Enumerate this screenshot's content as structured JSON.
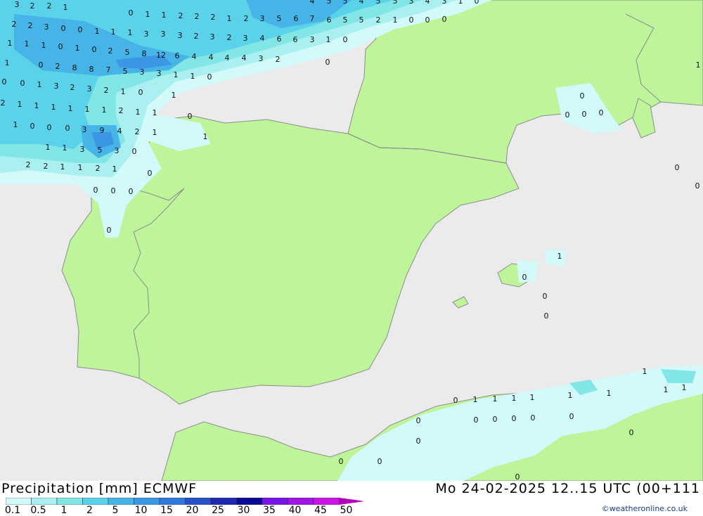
{
  "header": {
    "product": "Precipitation [mm]",
    "model": "ECMWF",
    "valid_time": "Mo 24-02-2025 12..15 UTC (00+111"
  },
  "legend": {
    "levels": [
      "0.1",
      "0.5",
      "1",
      "2",
      "5",
      "10",
      "15",
      "20",
      "25",
      "30",
      "35",
      "40",
      "45",
      "50"
    ],
    "colors": [
      "#d2fafa",
      "#aaf0f0",
      "#82e6e6",
      "#5ad2ea",
      "#46b4e6",
      "#3c96e6",
      "#3278dc",
      "#2850c8",
      "#1e28b4",
      "#0a0a96",
      "#7814e6",
      "#a014e6",
      "#c814e6",
      "#e614e6",
      "#f014c8",
      "#b400b4"
    ]
  },
  "credit": "©weatheronline.co.uk",
  "colors": {
    "sea": "#ebebeb",
    "land": "#bff59a",
    "border": "#8c8c8c"
  },
  "map_values": [
    {
      "t": "3"
    },
    {
      "t": "2"
    },
    {
      "t": "2"
    },
    {
      "t": "1"
    },
    {
      "t": "0"
    },
    {
      "t": "1"
    },
    {
      "t": "1"
    },
    {
      "t": "2"
    },
    {
      "t": "2"
    },
    {
      "t": "2"
    },
    {
      "t": "1"
    },
    {
      "t": "2"
    },
    {
      "t": "3"
    },
    {
      "t": "5"
    },
    {
      "t": "6"
    },
    {
      "t": "7"
    },
    {
      "t": "6"
    },
    {
      "t": "5"
    },
    {
      "t": "5"
    },
    {
      "t": "2"
    },
    {
      "t": "1"
    },
    {
      "t": "0"
    },
    {
      "t": "0"
    },
    {
      "t": "0"
    },
    {
      "t": "4"
    },
    {
      "t": "5"
    },
    {
      "t": "5"
    },
    {
      "t": "4"
    },
    {
      "t": "5"
    },
    {
      "t": "5"
    },
    {
      "t": "3"
    },
    {
      "t": "4"
    },
    {
      "t": "3"
    },
    {
      "t": "1"
    },
    {
      "t": "0"
    },
    {
      "t": "2"
    },
    {
      "t": "2"
    },
    {
      "t": "3"
    },
    {
      "t": "0"
    },
    {
      "t": "0"
    },
    {
      "t": "1"
    },
    {
      "t": "1"
    },
    {
      "t": "1"
    },
    {
      "t": "3"
    },
    {
      "t": "3"
    },
    {
      "t": "3"
    },
    {
      "t": "2"
    },
    {
      "t": "3"
    },
    {
      "t": "2"
    },
    {
      "t": "3"
    },
    {
      "t": "4"
    },
    {
      "t": "6"
    },
    {
      "t": "6"
    },
    {
      "t": "3"
    },
    {
      "t": "1"
    },
    {
      "t": "0"
    },
    {
      "t": "1"
    },
    {
      "t": "1"
    },
    {
      "t": "1"
    },
    {
      "t": "0"
    },
    {
      "t": "1"
    },
    {
      "t": "0"
    },
    {
      "t": "2"
    },
    {
      "t": "5"
    },
    {
      "t": "8"
    },
    {
      "t": "12"
    },
    {
      "t": "6"
    },
    {
      "t": "4"
    },
    {
      "t": "4"
    },
    {
      "t": "4"
    },
    {
      "t": "4"
    },
    {
      "t": "3"
    },
    {
      "t": "2"
    },
    {
      "t": "0"
    },
    {
      "t": "1"
    },
    {
      "t": "0"
    },
    {
      "t": "2"
    },
    {
      "t": "8"
    },
    {
      "t": "8"
    },
    {
      "t": "7"
    },
    {
      "t": "5"
    },
    {
      "t": "3"
    },
    {
      "t": "3"
    },
    {
      "t": "1"
    },
    {
      "t": "1"
    },
    {
      "t": "0"
    },
    {
      "t": "0"
    },
    {
      "t": "0"
    },
    {
      "t": "1"
    },
    {
      "t": "3"
    },
    {
      "t": "2"
    },
    {
      "t": "3"
    },
    {
      "t": "2"
    },
    {
      "t": "1"
    },
    {
      "t": "0"
    },
    {
      "t": "1"
    },
    {
      "t": "2"
    },
    {
      "t": "1"
    },
    {
      "t": "1"
    },
    {
      "t": "1"
    },
    {
      "t": "1"
    },
    {
      "t": "1"
    },
    {
      "t": "1"
    },
    {
      "t": "2"
    },
    {
      "t": "1"
    },
    {
      "t": "1"
    },
    {
      "t": "0"
    },
    {
      "t": "1"
    },
    {
      "t": "0"
    },
    {
      "t": "0"
    },
    {
      "t": "0"
    },
    {
      "t": "3"
    },
    {
      "t": "9"
    },
    {
      "t": "4"
    },
    {
      "t": "2"
    },
    {
      "t": "1"
    },
    {
      "t": "1"
    },
    {
      "t": "1"
    },
    {
      "t": "1"
    },
    {
      "t": "3"
    },
    {
      "t": "5"
    },
    {
      "t": "3"
    },
    {
      "t": "0"
    },
    {
      "t": "2"
    },
    {
      "t": "2"
    },
    {
      "t": "1"
    },
    {
      "t": "1"
    },
    {
      "t": "2"
    },
    {
      "t": "1"
    },
    {
      "t": "0"
    },
    {
      "t": "0"
    },
    {
      "t": "0"
    },
    {
      "t": "0"
    },
    {
      "t": "0"
    },
    {
      "t": "0"
    },
    {
      "t": "0"
    },
    {
      "t": "0"
    },
    {
      "t": "0"
    },
    {
      "t": "0"
    },
    {
      "t": "0"
    },
    {
      "t": "1"
    },
    {
      "t": "1"
    },
    {
      "t": "0"
    },
    {
      "t": "0"
    },
    {
      "t": "0"
    },
    {
      "t": "0"
    },
    {
      "t": "1"
    },
    {
      "t": "1"
    },
    {
      "t": "1"
    },
    {
      "t": "1"
    },
    {
      "t": "1"
    },
    {
      "t": "1"
    },
    {
      "t": "1"
    },
    {
      "t": "1"
    },
    {
      "t": "1"
    },
    {
      "t": "0"
    },
    {
      "t": "0"
    },
    {
      "t": "0"
    },
    {
      "t": "0"
    },
    {
      "t": "0"
    },
    {
      "t": "0"
    },
    {
      "t": "0"
    },
    {
      "t": "0"
    },
    {
      "t": "0"
    },
    {
      "t": "0"
    },
    {
      "t": "0"
    }
  ]
}
